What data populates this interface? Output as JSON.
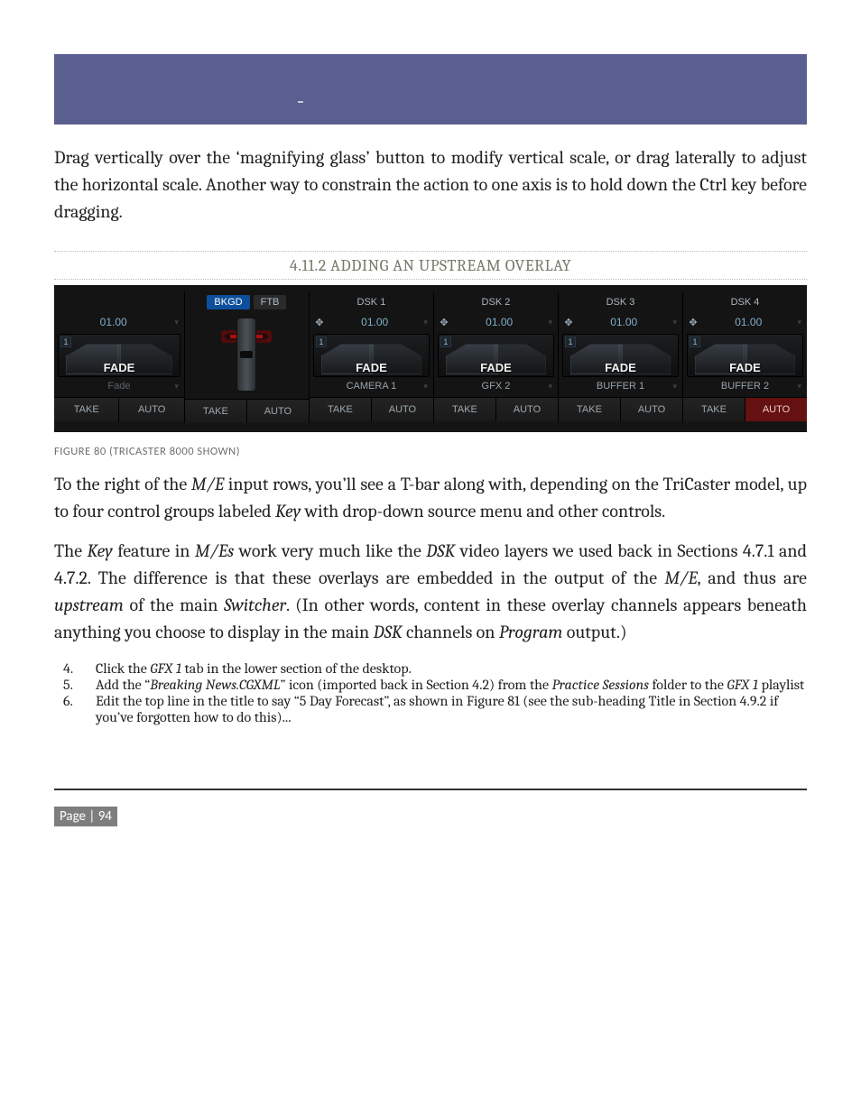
{
  "intro_paragraph": "Drag vertically over the ‘magnifying glass’ button to modify vertical scale, or drag laterally to adjust the horizontal scale.  Another way to constrain the action to one axis is to hold down the Ctrl key before dragging.",
  "section_title": "4.11.2 ADDING AN UPSTREAM OVERLAY",
  "figure": {
    "tbar_labels": {
      "bkgd": "BKGD",
      "ftb": "FTB"
    },
    "main": {
      "time": "01.00",
      "effect_badge": "1",
      "effect_label": "FADE",
      "source": "Fade",
      "take": "TAKE",
      "auto": "AUTO"
    },
    "tbar": {
      "take": "TAKE",
      "auto": "AUTO"
    },
    "dsks": [
      {
        "title": "DSK 1",
        "time": "01.00",
        "effect_badge": "1",
        "effect_label": "FADE",
        "source": "CAMERA 1",
        "take": "TAKE",
        "auto": "AUTO"
      },
      {
        "title": "DSK 2",
        "time": "01.00",
        "effect_badge": "1",
        "effect_label": "FADE",
        "source": "GFX 2",
        "take": "TAKE",
        "auto": "AUTO"
      },
      {
        "title": "DSK 3",
        "time": "01.00",
        "effect_badge": "1",
        "effect_label": "FADE",
        "source": "BUFFER 1",
        "take": "TAKE",
        "auto": "AUTO"
      },
      {
        "title": "DSK 4",
        "time": "01.00",
        "effect_badge": "1",
        "effect_label": "FADE",
        "source": "BUFFER 2",
        "take": "TAKE",
        "auto": "AUTO"
      }
    ]
  },
  "figure_caption": "FIGURE 80 (TRICASTER 8000 SHOWN)",
  "para2_parts": [
    "To the right of the ",
    "M/E",
    " input rows, you’ll see a T-bar along with, depending on the TriCaster model, up to four control groups labeled ",
    "Key",
    " with drop-down source menu and other controls."
  ],
  "para3_parts": [
    "The ",
    "Key",
    " feature in ",
    "M/Es",
    " work very much like the ",
    "DSK",
    " video layers we used back in Sections 4.7.1 and 4.7.2.  The difference is that these overlays are embedded in the output of the ",
    "M/E",
    ", and thus are ",
    "upstream",
    " of the main ",
    "Switcher",
    ".  (In other words, content in these overlay channels appears beneath anything you choose to display in the main ",
    "DSK",
    " channels on ",
    "Program",
    " output.)"
  ],
  "steps": {
    "n4": {
      "num": "4.",
      "pre": "Click the ",
      "i": "GFX 1",
      "post": " tab in the lower section of the desktop."
    },
    "n5": {
      "num": "5.",
      "a": "Add the “",
      "b": "Breaking News.CGXML",
      "c": "” icon (imported back in Section 4.2) from the ",
      "d": "Practice Sessions",
      "e": " folder to the ",
      "f": "GFX 1",
      "g": " playlist"
    },
    "n6": {
      "num": "6.",
      "text": "Edit the top line in the title to say “5 Day Forecast”, as shown in Figure 81 (see the sub-heading Title in Section 4.9.2 if you’ve forgotten how to do this)..."
    }
  },
  "page_label": "Page | 94"
}
